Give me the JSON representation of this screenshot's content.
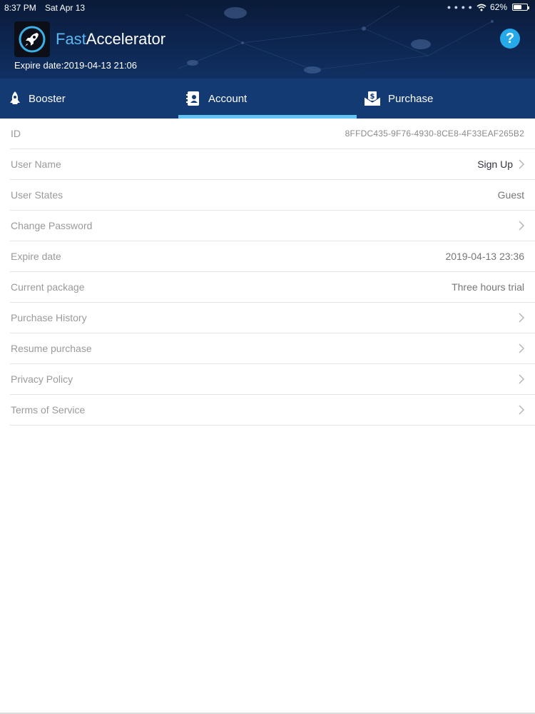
{
  "status_bar": {
    "time": "8:37 PM",
    "date": "Sat Apr 13",
    "battery": "62%",
    "battery_level": 0.62
  },
  "header": {
    "title_part1": "Fast",
    "title_part2": "Accelerator",
    "expire_text": "Expire date:2019-04-13 21:06",
    "help_symbol": "?",
    "logo_icon": "rocket-icon",
    "accent_color": "#5cb8ee"
  },
  "tabs": [
    {
      "label": "Booster",
      "icon": "rocket-icon",
      "active": false
    },
    {
      "label": "Account",
      "icon": "contact-book-icon",
      "active": true
    },
    {
      "label": "Purchase",
      "icon": "dollar-envelope-icon",
      "active": false
    }
  ],
  "account_rows": [
    {
      "label": "ID",
      "value": "8FFDC435-9F76-4930-8CE8-4F33EAF265B2",
      "chevron": false
    },
    {
      "label": "User Name",
      "value": "Sign Up",
      "chevron": true
    },
    {
      "label": "User States",
      "value": "Guest",
      "chevron": false
    },
    {
      "label": "Change Password",
      "value": "",
      "chevron": true
    },
    {
      "label": "Expire date",
      "value": "2019-04-13 23:36",
      "chevron": false
    },
    {
      "label": "Current package",
      "value": "Three hours trial",
      "chevron": false
    },
    {
      "label": "Purchase History",
      "value": "",
      "chevron": true
    },
    {
      "label": "Resume purchase",
      "value": "",
      "chevron": true
    },
    {
      "label": "Privacy Policy",
      "value": "",
      "chevron": true
    },
    {
      "label": "Terms of Service",
      "value": "",
      "chevron": true
    }
  ]
}
